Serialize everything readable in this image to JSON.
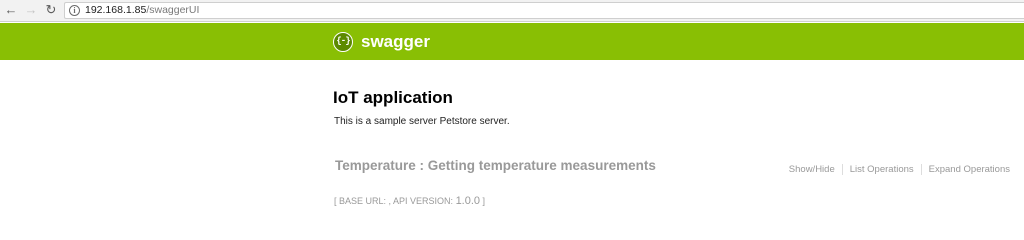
{
  "browser": {
    "url_host": "192.168.1.85",
    "url_path": "/swaggerUI",
    "back_icon": "back-arrow-icon",
    "forward_icon": "forward-arrow-icon",
    "reload_icon": "reload-icon",
    "info_icon": "info-icon"
  },
  "header": {
    "logo_mark": "{-}",
    "logo_text": "swagger",
    "background": "#89bf04"
  },
  "api": {
    "title": "IoT application",
    "description": "This is a sample server Petstore server."
  },
  "resource": {
    "title": "Temperature : Getting temperature measurements",
    "show_hide": "Show/Hide",
    "list_operations": "List Operations",
    "expand_operations": "Expand Operations"
  },
  "footer_info": {
    "open_bracket": "[ ",
    "base_url_label": "BASE URL: , API VERSION: ",
    "version": "1.0.0",
    "close_bracket": " ]"
  }
}
